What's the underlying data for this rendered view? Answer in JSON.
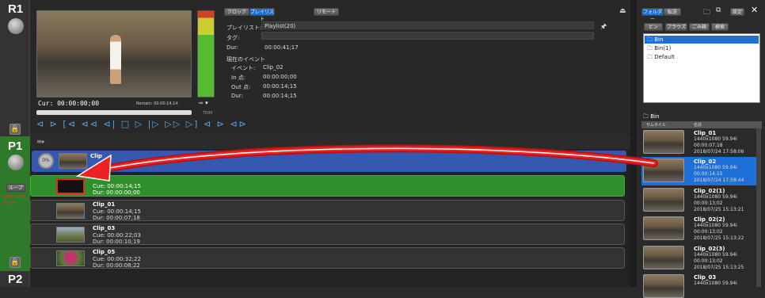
{
  "channels": {
    "r1": "R1",
    "p1": "P1",
    "p2": "P2"
  },
  "player": {
    "cur": "Cur: 00:00:00;00",
    "remain": "Remain: 00:00:14,14",
    "trim": "TRIM",
    "arrow_label": "⇨ ▾"
  },
  "top_tabs": {
    "clock": "クロック",
    "playlist": "プレイリスト",
    "remote": "リモート"
  },
  "info": {
    "playlist_label": "プレイリスト:",
    "playlist_value": "Playlist(20)",
    "tag_label": "タグ:",
    "dur_label": "Dur:",
    "dur_value": "00:00:41;17",
    "current_event": "現在のイベント",
    "event_label": "イベント:",
    "event_value": "Clip_02",
    "in_label": "In 点:",
    "in_value": "00:00:00;00",
    "out_label": "Out 点:",
    "out_value": "00:00:14;15",
    "dur2_label": "Dur:",
    "dur2_value": "00:00:14;15"
  },
  "left_side": {
    "loop": "ループ",
    "fmt1": "1440x1080",
    "fmt2": "59.94i"
  },
  "playlist": {
    "header_clip": "Clip",
    "percent": "0%",
    "rows": [
      {
        "name": "",
        "cue": "Cue: 00:00:14;15",
        "dur": "Dur: 00:00:00;00"
      },
      {
        "name": "Clip_01",
        "cue": "Cue: 00:00:14;15",
        "dur": "Dur: 00:00:07;18"
      },
      {
        "name": "Clip_03",
        "cue": "Cue: 00:00:22;03",
        "dur": "Dur: 00:00:10;19"
      },
      {
        "name": "Clip_05",
        "cue": "Cue: 00:00:32;22",
        "dur": "Dur: 00:00:08;22"
      }
    ]
  },
  "right": {
    "tab_folder": "フォルダー",
    "tab_transfer": "転送",
    "settings": "設定",
    "subtabs": [
      "ビン",
      "ブラウズ",
      "ごみ箱",
      "検索"
    ],
    "tree": [
      "Bin",
      "Bin(1)",
      "Default"
    ],
    "bin_title": "Bin",
    "col_thumb": "サムネイル",
    "col_name": "名前",
    "clips": [
      {
        "name": "Clip_01",
        "fmt": "1440x1080 59.94i",
        "dur": "00:00:07;18",
        "date": "2018/07/24 17:58:06"
      },
      {
        "name": "Clip_02",
        "fmt": "1440x1080 59.94i",
        "dur": "00:00:14;15",
        "date": "2018/07/24 17:58:44"
      },
      {
        "name": "Clip_02(1)",
        "fmt": "1440x1080 59.94i",
        "dur": "00:00:13;02",
        "date": "2018/07/25 15:13:21"
      },
      {
        "name": "Clip_02(2)",
        "fmt": "1440x1080 59.94i",
        "dur": "00:00:13;02",
        "date": "2018/07/25 15:13:22"
      },
      {
        "name": "Clip_02(3)",
        "fmt": "1440x1080 59.94i",
        "dur": "00:00:13;02",
        "date": "2018/07/25 15:13:25"
      },
      {
        "name": "Clip_03",
        "fmt": "1440x1080 59.94i",
        "dur": "",
        "date": ""
      }
    ]
  },
  "colors": {
    "accent_blue": "#1e6fd6",
    "active_green": "#2f8f2a",
    "arrow_red": "#d81e1e"
  }
}
